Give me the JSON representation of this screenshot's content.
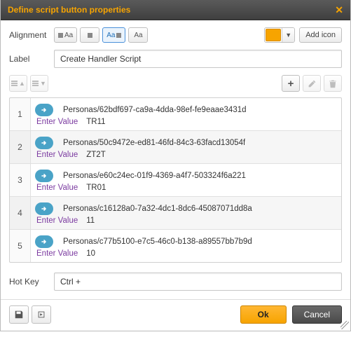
{
  "dialog": {
    "title": "Define script button properties"
  },
  "alignment": {
    "label": "Alignment",
    "options": [
      "icon-text",
      "icon-only",
      "text-icon",
      "text-only"
    ],
    "selected_index": 2
  },
  "toolbar_right": {
    "add_icon_label": "Add icon",
    "color_swatch": "#f7a400"
  },
  "label_field": {
    "label": "Label",
    "value": "Create Handler Script"
  },
  "script_list": {
    "enter_value_label": "Enter Value",
    "items": [
      {
        "path": "Personas/62bdf697-ca9a-4dda-98ef-fe9eaae3431d",
        "value": "TR11"
      },
      {
        "path": "Personas/50c9472e-ed81-46fd-84c3-63facd13054f",
        "value": "ZT2T"
      },
      {
        "path": "Personas/e60c24ec-01f9-4369-a4f7-503324f6a221",
        "value": "TR01"
      },
      {
        "path": "Personas/c16128a0-7a32-4dc1-8dc6-45087071dd8a",
        "value": "11"
      },
      {
        "path": "Personas/c77b5100-e7c5-46c0-b138-a89557bb7b9d",
        "value": "10"
      }
    ]
  },
  "hotkey": {
    "label": "Hot Key",
    "value": "Ctrl +"
  },
  "footer": {
    "ok": "Ok",
    "cancel": "Cancel"
  }
}
